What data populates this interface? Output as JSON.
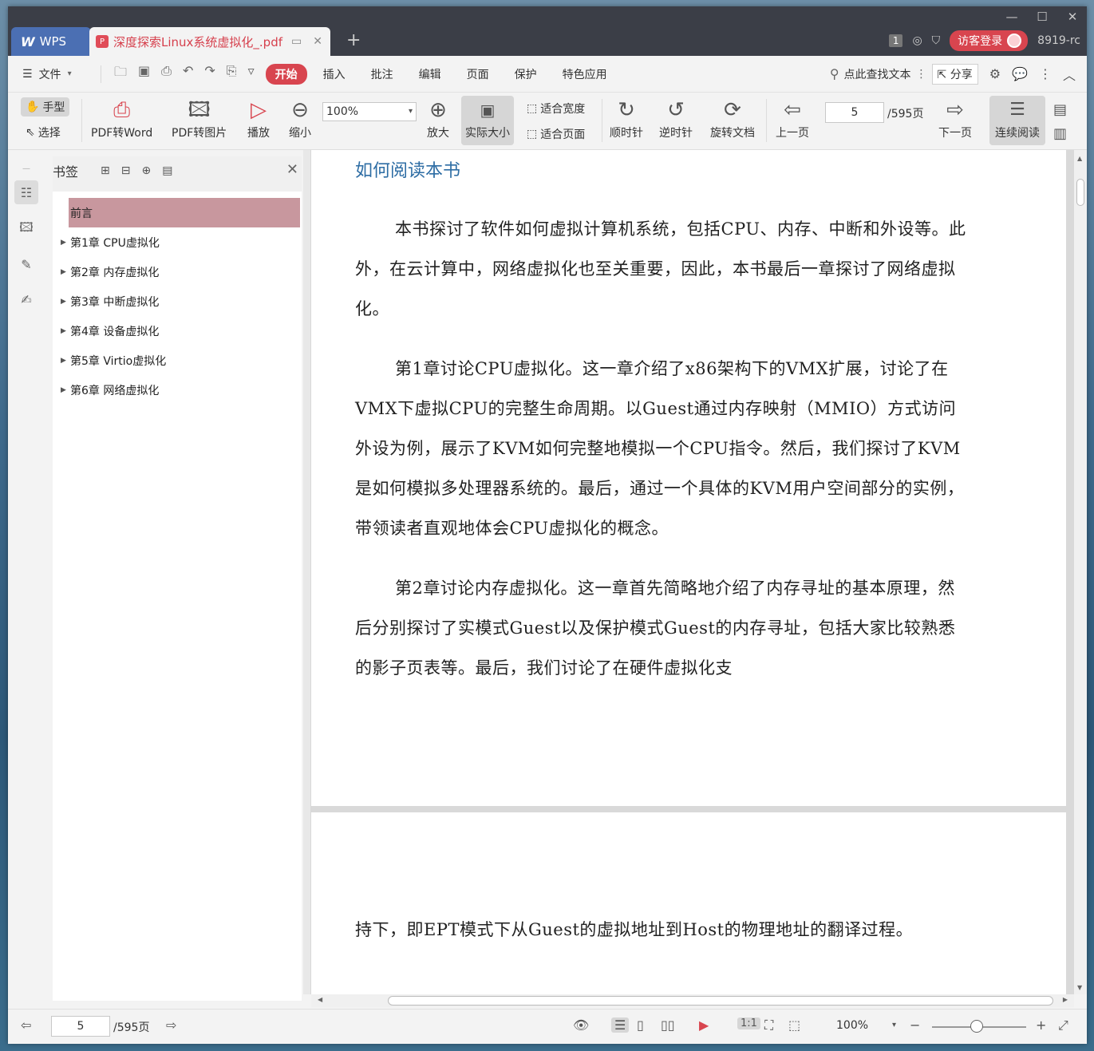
{
  "titlebar": {
    "app_tab": "WPS",
    "app_logo": "W",
    "doc_tab": "深度探索Linux系统虚拟化_.pdf",
    "pdf_badge": "P",
    "badge_count": "1",
    "login_label": "访客登录",
    "user_id": "8919-rc"
  },
  "menubar": {
    "file_label": "文件",
    "items": [
      "开始",
      "插入",
      "批注",
      "编辑",
      "页面",
      "保护",
      "特色应用"
    ],
    "active_item": "开始",
    "search_label": "点此查找文本",
    "share_label": "分享"
  },
  "toolbar": {
    "hand_label": "手型",
    "select_label": "选择",
    "pdf_to_word": "PDF转Word",
    "pdf_to_image": "PDF转图片",
    "play": "播放",
    "zoom_out": "缩小",
    "zoom_value": "100%",
    "zoom_in": "放大",
    "actual_size": "实际大小",
    "fit_width": "适合宽度",
    "fit_page": "适合页面",
    "clockwise": "顺时针",
    "counter_clockwise": "逆时针",
    "rotate_doc": "旋转文档",
    "prev_page": "上一页",
    "page_current": "5",
    "page_total": "/595页",
    "next_page": "下一页",
    "continuous_read": "连续阅读"
  },
  "bookmarks": {
    "title": "书签",
    "items": [
      {
        "label": "前言",
        "selected": true,
        "expandable": false
      },
      {
        "label": "第1章 CPU虚拟化",
        "expandable": true
      },
      {
        "label": "第2章 内存虚拟化",
        "expandable": true
      },
      {
        "label": "第3章 中断虚拟化",
        "expandable": true
      },
      {
        "label": "第4章 设备虚拟化",
        "expandable": true
      },
      {
        "label": "第5章 Virtio虚拟化",
        "expandable": true
      },
      {
        "label": "第6章 网络虚拟化",
        "expandable": true
      }
    ]
  },
  "document": {
    "heading": "如何阅读本书",
    "paragraphs": [
      "本书探讨了软件如何虚拟计算机系统，包括CPU、内存、中断和外设等。此外，在云计算中，网络虚拟化也至关重要，因此，本书最后一章探讨了网络虚拟化。",
      "第1章讨论CPU虚拟化。这一章介绍了x86架构下的VMX扩展，讨论了在VMX下虚拟CPU的完整生命周期。以Guest通过内存映射（MMIO）方式访问外设为例，展示了KVM如何完整地模拟一个CPU指令。然后，我们探讨了KVM是如何模拟多处理器系统的。最后，通过一个具体的KVM用户空间部分的实例，带领读者直观地体会CPU虚拟化的概念。",
      "第2章讨论内存虚拟化。这一章首先简略地介绍了内存寻址的基本原理，然后分别探讨了实模式Guest以及保护模式Guest的内存寻址，包括大家比较熟悉的影子页表等。最后，我们讨论了在硬件虚拟化支"
    ],
    "page2_text": "持下，即EPT模式下从Guest的虚拟地址到Host的物理地址的翻译过程。"
  },
  "statusbar": {
    "page_current": "5",
    "page_total": "/595页",
    "zoom": "100%"
  },
  "colors": {
    "accent": "#d8454f",
    "titlebar": "#3b3e47",
    "heading": "#2e6da4",
    "bookmark_selected": "#c8979e"
  }
}
